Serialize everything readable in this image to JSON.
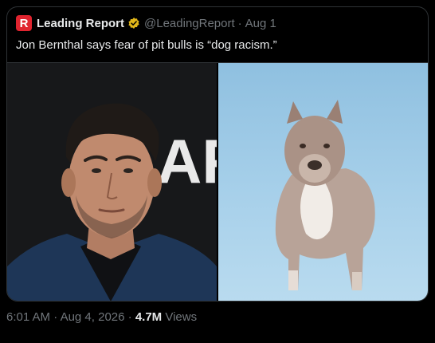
{
  "quoted_tweet": {
    "logo_letter": "R",
    "author": "Leading Report",
    "handle": "@LeadingReport",
    "separator": "·",
    "date": "Aug 1",
    "text": "Jon Bernthal says fear of pit bulls is “dog racism.”",
    "backdrop_text": "AF",
    "colors": {
      "logo_red": "#e0242f",
      "verified_gold": "#e2b719"
    }
  },
  "meta": {
    "time": "6:01 AM",
    "dot": "·",
    "date": "Aug 4, 2026",
    "views_count": "4.7M",
    "views_label": "Views"
  }
}
